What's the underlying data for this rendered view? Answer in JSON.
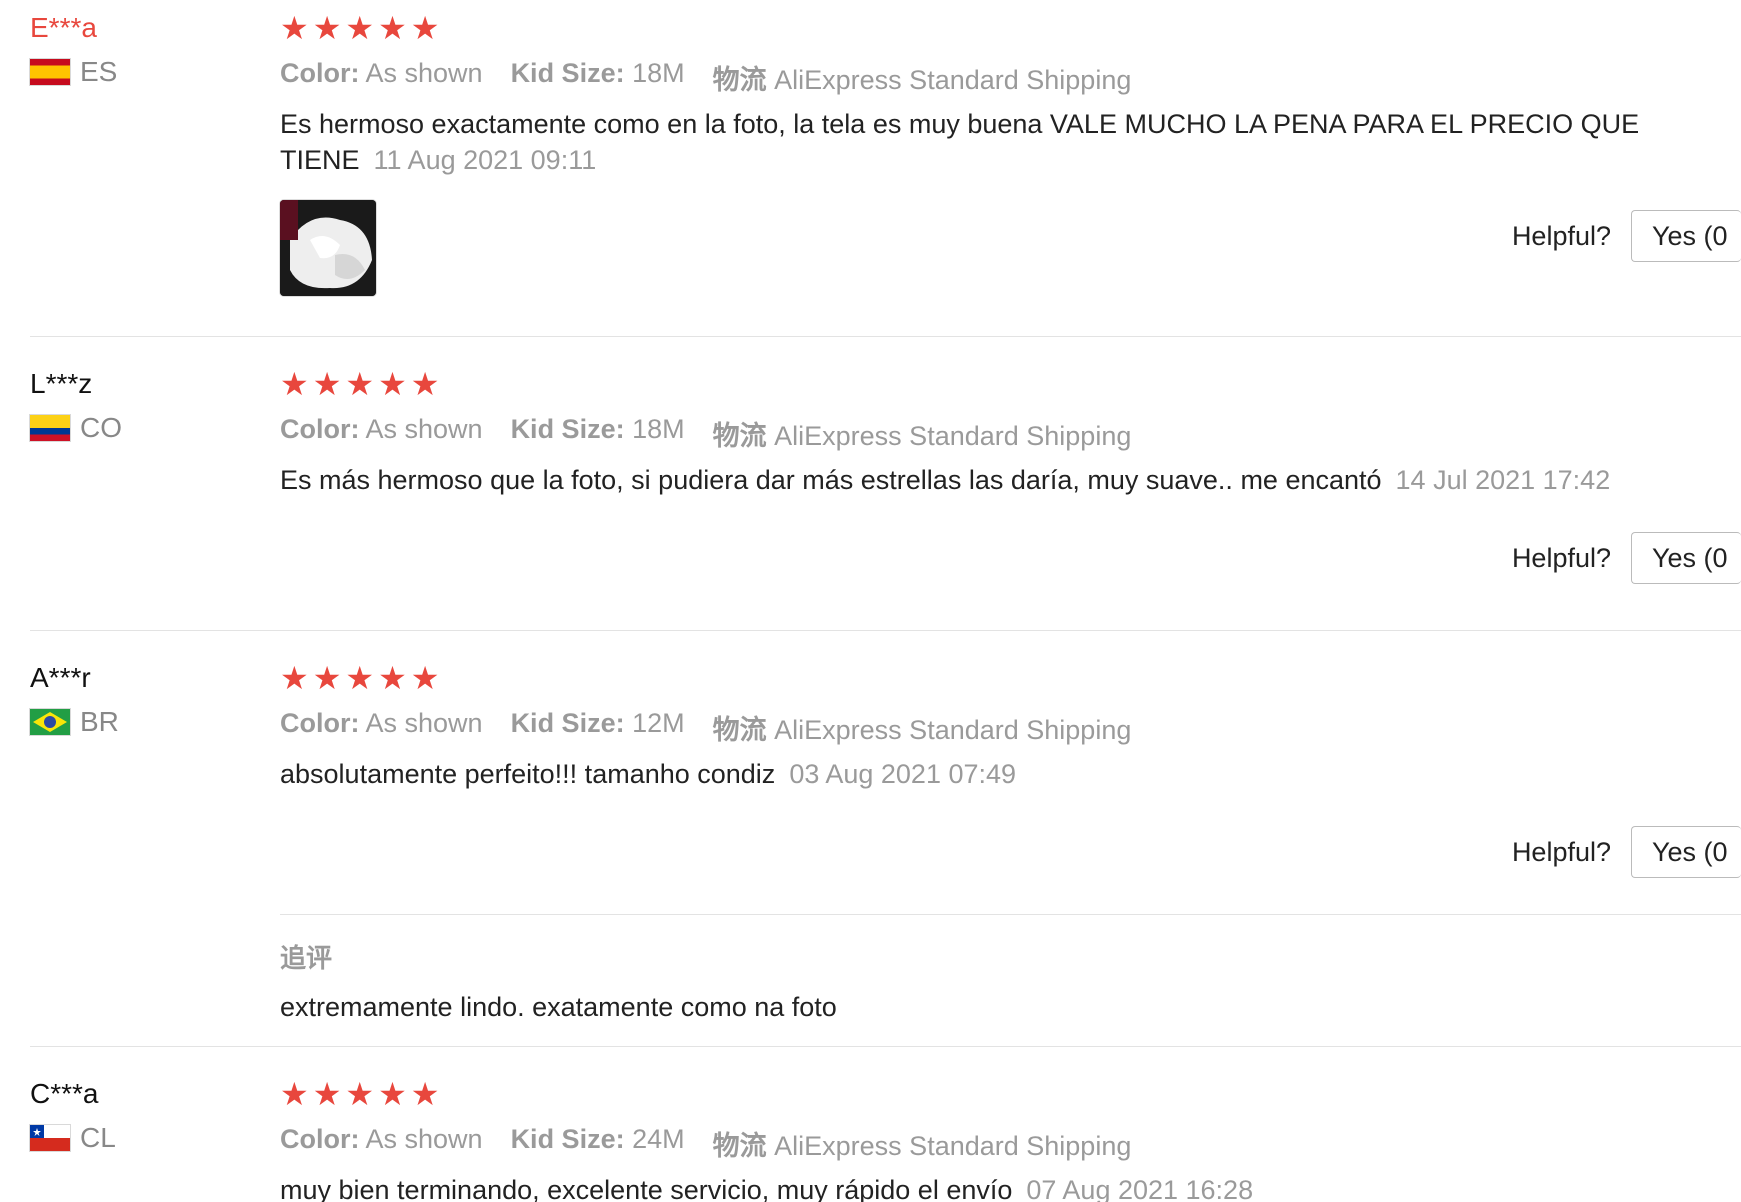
{
  "reviews": [
    {
      "username": "E***a",
      "country": "ES",
      "rating": 5,
      "color_label": "Color:",
      "color_value": "As shown",
      "size_label": "Kid Size:",
      "size_value": "18M",
      "shipping_label": "物流",
      "shipping_value": "AliExpress Standard Shipping",
      "text": "Es hermoso exactamente como en la foto, la tela es muy buena VALE MUCHO LA PENA PARA EL PRECIO QUE TIENE",
      "date": "11 Aug 2021 09:11",
      "helpful_label": "Helpful?",
      "yes_label": "Yes (0"
    },
    {
      "username": "L***z",
      "country": "CO",
      "rating": 5,
      "color_label": "Color:",
      "color_value": "As shown",
      "size_label": "Kid Size:",
      "size_value": "18M",
      "shipping_label": "物流",
      "shipping_value": "AliExpress Standard Shipping",
      "text": "Es más hermoso que la foto, si pudiera dar más estrellas las daría, muy suave.. me encantó",
      "date": "14 Jul 2021 17:42",
      "helpful_label": "Helpful?",
      "yes_label": "Yes (0"
    },
    {
      "username": "A***r",
      "country": "BR",
      "rating": 5,
      "color_label": "Color:",
      "color_value": "As shown",
      "size_label": "Kid Size:",
      "size_value": "12M",
      "shipping_label": "物流",
      "shipping_value": "AliExpress Standard Shipping",
      "text": "absolutamente perfeito!!! tamanho condiz",
      "date": "03 Aug 2021 07:49",
      "helpful_label": "Helpful?",
      "yes_label": "Yes (0",
      "additional_label": "追评",
      "additional_text": "extremamente lindo. exatamente como na foto"
    },
    {
      "username": "C***a",
      "country": "CL",
      "rating": 5,
      "color_label": "Color:",
      "color_value": "As shown",
      "size_label": "Kid Size:",
      "size_value": "24M",
      "shipping_label": "物流",
      "shipping_value": "AliExpress Standard Shipping",
      "text": "muy bien terminando, excelente servicio, muy rápido el envío",
      "date": "07 Aug 2021 16:28"
    }
  ],
  "colors": {
    "accent": "#e8473d",
    "muted": "#9a9a9a",
    "divider": "#e3e3e3"
  },
  "icons": {
    "star": "star-icon",
    "flags": [
      "spain-flag-icon",
      "colombia-flag-icon",
      "brazil-flag-icon",
      "chile-flag-icon"
    ]
  }
}
